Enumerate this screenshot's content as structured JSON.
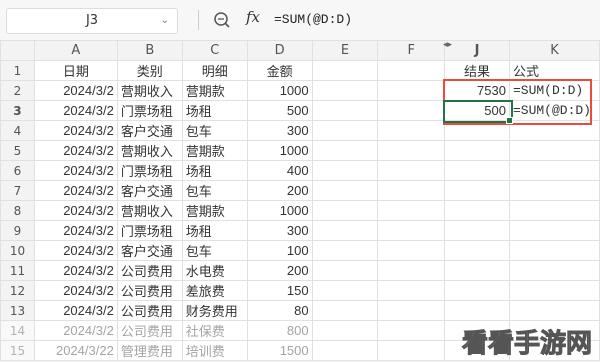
{
  "formula_bar": {
    "name_box": "J3",
    "fx_label": "fx",
    "formula": "=SUM(@D:D)"
  },
  "columns": [
    "A",
    "B",
    "C",
    "D",
    "E",
    "F",
    "J",
    "K"
  ],
  "rows": [
    {
      "n": "1",
      "a": "日期",
      "b": "类别",
      "c": "明细",
      "d": "金额",
      "j": "结果",
      "k": "公式"
    },
    {
      "n": "2",
      "a": "2024/3/2",
      "b": "营期收入",
      "c": "营期款",
      "d": "1000",
      "j": "7530",
      "k": "=SUM(D:D)"
    },
    {
      "n": "3",
      "a": "2024/3/2",
      "b": "门票场租",
      "c": "场租",
      "d": "500",
      "j": "500",
      "k": "=SUM(@D:D)"
    },
    {
      "n": "4",
      "a": "2024/3/2",
      "b": "客户交通",
      "c": "包车",
      "d": "300",
      "j": "",
      "k": ""
    },
    {
      "n": "5",
      "a": "2024/3/2",
      "b": "营期收入",
      "c": "营期款",
      "d": "1000",
      "j": "",
      "k": ""
    },
    {
      "n": "6",
      "a": "2024/3/2",
      "b": "门票场租",
      "c": "场租",
      "d": "400",
      "j": "",
      "k": ""
    },
    {
      "n": "7",
      "a": "2024/3/2",
      "b": "客户交通",
      "c": "包车",
      "d": "200",
      "j": "",
      "k": ""
    },
    {
      "n": "8",
      "a": "2024/3/2",
      "b": "营期收入",
      "c": "营期款",
      "d": "1000",
      "j": "",
      "k": ""
    },
    {
      "n": "9",
      "a": "2024/3/2",
      "b": "门票场租",
      "c": "场租",
      "d": "300",
      "j": "",
      "k": ""
    },
    {
      "n": "10",
      "a": "2024/3/2",
      "b": "客户交通",
      "c": "包车",
      "d": "100",
      "j": "",
      "k": ""
    },
    {
      "n": "11",
      "a": "2024/3/2",
      "b": "公司费用",
      "c": "水电费",
      "d": "200",
      "j": "",
      "k": ""
    },
    {
      "n": "12",
      "a": "2024/3/2",
      "b": "公司费用",
      "c": "差旅费",
      "d": "150",
      "j": "",
      "k": ""
    },
    {
      "n": "13",
      "a": "2024/3/2",
      "b": "公司费用",
      "c": "财务费用",
      "d": "80",
      "j": "",
      "k": ""
    },
    {
      "n": "14",
      "a": "2024/3/2",
      "b": "公司费用",
      "c": "社保费",
      "d": "800",
      "j": "",
      "k": ""
    },
    {
      "n": "15",
      "a": "2024/3/22",
      "b": "管理费用",
      "c": "培训费",
      "d": "1500",
      "j": "",
      "k": ""
    }
  ],
  "watermark": "看看手游网",
  "colors": {
    "highlight_box": "#e74c3c",
    "active_cell": "#217346"
  }
}
